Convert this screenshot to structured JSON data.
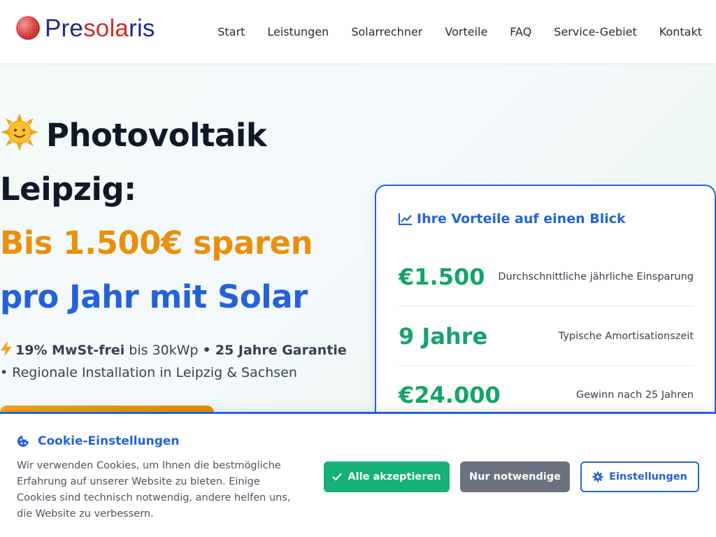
{
  "brand": {
    "logo_pre": "Pre",
    "logo_sol": "sola",
    "logo_ris": "ris",
    "colors": {
      "primary_blue": "#2462d6",
      "logo_navy": "#1f2a8a",
      "logo_red": "#d62a2a",
      "accent_orange": "#e8900c",
      "success_green": "#16a36a"
    }
  },
  "nav": {
    "items": [
      "Start",
      "Leistungen",
      "Solarrechner",
      "Vorteile",
      "FAQ",
      "Service-Gebiet",
      "Kontakt"
    ]
  },
  "hero": {
    "title_line1": "Photovoltaik",
    "title_line2": "Leipzig:",
    "title_line3": "Bis 1.500€ sparen",
    "title_line4": "pro Jahr mit Solar",
    "sub_mwst": "19% MwSt-frei",
    "sub_bis": "bis 30kWp",
    "sub_bullet1": "•",
    "sub_garantie": "25 Jahre Garantie",
    "sub_line2": "• Regionale Installation in Leipzig & Sachsen",
    "icons": {
      "title": "sun-face-icon",
      "subtitle": "lightning-bolt-icon"
    }
  },
  "benefits": {
    "title": "Ihre Vorteile auf einen Blick",
    "icon": "line-chart-icon",
    "stats": [
      {
        "value": "€1.500",
        "label": "Durchschnittliche jährliche Einsparung"
      },
      {
        "value": "9 Jahre",
        "label": "Typische Amortisationszeit"
      },
      {
        "value": "€24.000",
        "label": "Gewinn nach 25 Jahren"
      }
    ]
  },
  "cookie": {
    "title": "Cookie-Einstellungen",
    "text": "Wir verwenden Cookies, um Ihnen die bestmögliche Erfahrung auf unserer Website zu bieten. Einige Cookies sind technisch notwendig, andere helfen uns, die Website zu verbessern.",
    "accept_label": "Alle akzeptieren",
    "necessary_label": "Nur notwendige",
    "settings_label": "Einstellungen",
    "icons": {
      "title": "cookie-icon",
      "accept": "check-icon",
      "settings": "gear-icon"
    }
  }
}
